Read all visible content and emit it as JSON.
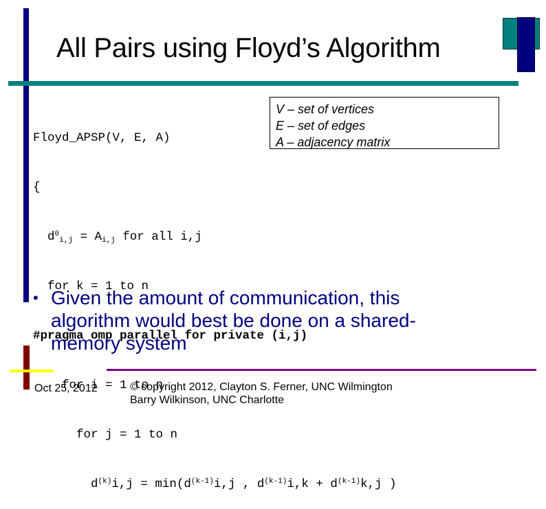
{
  "slide": {
    "title": "All Pairs using Floyd’s Algorithm",
    "code": {
      "line1": "Floyd_APSP(V, E, A)",
      "line2": "{",
      "line3": {
        "indent": "  ",
        "d": "d",
        "d_sup": "0",
        "d_sub": "i,j",
        "eq": " = A",
        "a_sub": "i,j",
        "rest": " for all i,j"
      },
      "line4": "  for k = 1 to n",
      "line5": "#pragma omp parallel for private (i,j)",
      "line6": "    for i = 1 to n",
      "line7": "      for j = 1 to n",
      "line8": {
        "indent": "        ",
        "p1": "d",
        "s1": "(k)",
        "p2": "i,j = min(d",
        "s2": "(k-1)",
        "p3": "i,j , d",
        "s3": "(k-1)",
        "p4": "i,k + d",
        "s4": "(k-1)",
        "p5": "k,j )"
      }
    },
    "legend": [
      "V – set of vertices",
      "E – set of edges",
      "A – adjacency matrix"
    ],
    "bullet": {
      "marker": "•",
      "text": "Given the amount of communication, this algorithm would best be done on a shared-memory system"
    },
    "footer": {
      "date": "Oct 25, 2012",
      "copyright_line1": "© copyright 2012, Clayton S. Ferner, UNC Wilmington",
      "copyright_line2": "Barry Wilkinson, UNC Charlotte"
    },
    "colors": {
      "navy": "#000080",
      "teal": "#008080",
      "maroon": "#800000",
      "yellow": "#ffff00",
      "purple": "#800080"
    }
  }
}
